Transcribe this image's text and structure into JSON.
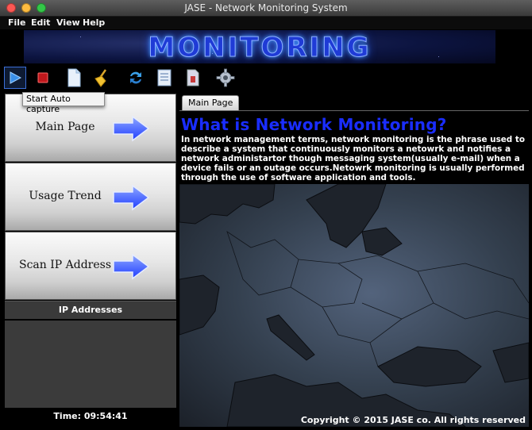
{
  "window": {
    "title": "JASE - Network Monitoring System"
  },
  "menu": [
    "File",
    "Edit",
    "View",
    "Help"
  ],
  "banner": {
    "text": "MONITORING"
  },
  "toolbar": {
    "tooltip": "Start Auto capture",
    "icons": [
      "play-icon",
      "stop-icon",
      "document-icon",
      "broom-icon",
      "refresh-icon",
      "report-icon",
      "file-export-icon",
      "gear-icon"
    ]
  },
  "sidebar": {
    "buttons": [
      "Main Page",
      "Usage Trend",
      "Scan IP Address"
    ],
    "ip_header": "IP Addresses",
    "time": "Time: 09:54:41"
  },
  "main": {
    "tab": "Main Page",
    "heading": "What is Network Monitoring?",
    "paragraph": "In network management terms, network monitoring is the phrase used to describe a system that continuously monitors a netowrk and notifies a network administartor though messaging system(usually e-mail) when a device fails or an outage occurs.Netowrk monitoring is usually performed through the use of software application and tools.",
    "copyright": "Copyright © 2015 JASE co.  All rights reserved"
  },
  "colors": {
    "heading": "#1a2dff",
    "banner": "#1f3bd6",
    "arrow": "#2b55ff"
  }
}
